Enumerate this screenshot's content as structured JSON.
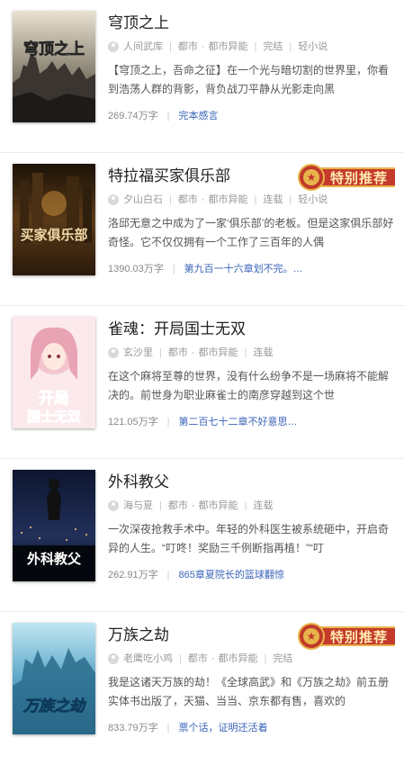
{
  "books": [
    {
      "title": "穹顶之上",
      "author": "人间武库",
      "category": "都市",
      "subcategory": "都市异能",
      "status": "完结",
      "tag": "轻小说",
      "description": "【穹顶之上，吾命之征】在一个光与暗切割的世界里，你看到浩荡人群的背影，背负战刀平静从光影走向黑",
      "word_count": "269.74万字",
      "latest": "完本感言",
      "featured": false,
      "cover_title": "穹顶之上"
    },
    {
      "title": "特拉福买家俱乐部",
      "author": "夕山白石",
      "category": "都市",
      "subcategory": "都市异能",
      "status": "连载",
      "tag": "轻小说",
      "description": "洛邱无意之中成为了一家‘俱乐部’的老板。但是这家俱乐部好奇怪。它不仅仅拥有一个工作了三百年的人偶",
      "word_count": "1390.03万字",
      "latest": "第九百一十六章划不完。…",
      "featured": true,
      "cover_title": "特拉福买家俱乐部"
    },
    {
      "title": "雀魂：开局国士无双",
      "author": "玄沙里",
      "category": "都市",
      "subcategory": "都市异能",
      "status": "连载",
      "tag": "",
      "description": "在这个麻将至尊的世界，没有什么纷争不是一场麻将不能解决的。前世身为职业麻雀士的南彦穿越到这个世",
      "word_count": "121.05万字",
      "latest": "第二百七十二章不好意思…",
      "featured": false,
      "cover_title": "开局国士无双"
    },
    {
      "title": "外科教父",
      "author": "海与夏",
      "category": "都市",
      "subcategory": "都市异能",
      "status": "连载",
      "tag": "",
      "description": "一次深夜抢救手术中。年轻的外科医生被系统砸中，开启奇异的人生。“叮咚！奖励三千例断指再植！”“叮",
      "word_count": "262.91万字",
      "latest": "865章夏院长的篮球翻惊",
      "featured": false,
      "cover_title": "外科教父"
    },
    {
      "title": "万族之劫",
      "author": "老鹰吃小鸡",
      "category": "都市",
      "subcategory": "都市异能",
      "status": "完结",
      "tag": "",
      "description": "我是这诸天万族的劫！《全球高武》和《万族之劫》前五册实体书出版了，天猫、当当、京东都有售，喜欢的",
      "word_count": "833.79万字",
      "latest": "票个话，证明还活着",
      "featured": true,
      "cover_title": "万族之劫"
    }
  ],
  "badge_label": "特别推荐",
  "colors": {
    "chapter_link": "#3a64b8",
    "badge_red": "#c43a2c",
    "badge_gold": "#e8b44a"
  }
}
